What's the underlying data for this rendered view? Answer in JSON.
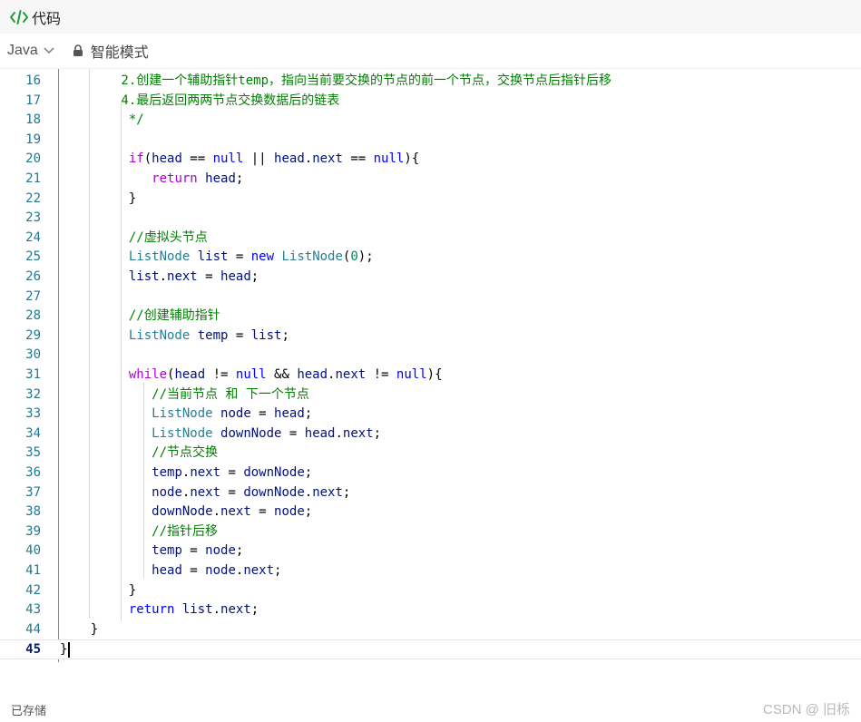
{
  "header": {
    "title": "代码",
    "icon": "code-icon"
  },
  "toolbar": {
    "language": "Java",
    "mode": "智能模式"
  },
  "editor": {
    "current_line": 45,
    "lines": [
      {
        "n": "16",
        "segs": [
          [
            "cm",
            "        2.创建一个辅助指针temp，指向当前要交换的节点的前一个节点，交换节点后指针后移"
          ]
        ]
      },
      {
        "n": "17",
        "segs": [
          [
            "cm",
            "        4.最后返回两两节点交换数据后的链表"
          ]
        ]
      },
      {
        "n": "18",
        "segs": [
          [
            "cm",
            "         */"
          ]
        ]
      },
      {
        "n": "19",
        "segs": []
      },
      {
        "n": "20",
        "segs": [
          [
            "pl",
            "         "
          ],
          [
            "kw",
            "if"
          ],
          [
            "pl",
            "("
          ],
          [
            "id",
            "head"
          ],
          [
            "pl",
            " == "
          ],
          [
            "kw2",
            "null"
          ],
          [
            "pl",
            " || "
          ],
          [
            "id",
            "head"
          ],
          [
            "pl",
            "."
          ],
          [
            "id",
            "next"
          ],
          [
            "pl",
            " == "
          ],
          [
            "kw2",
            "null"
          ],
          [
            "pl",
            "){"
          ]
        ]
      },
      {
        "n": "21",
        "segs": [
          [
            "pl",
            "            "
          ],
          [
            "kw",
            "return"
          ],
          [
            "pl",
            " "
          ],
          [
            "id",
            "head"
          ],
          [
            "pl",
            ";"
          ]
        ]
      },
      {
        "n": "22",
        "segs": [
          [
            "pl",
            "         }"
          ]
        ]
      },
      {
        "n": "23",
        "segs": []
      },
      {
        "n": "24",
        "segs": [
          [
            "cm",
            "         //虚拟头节点"
          ]
        ]
      },
      {
        "n": "25",
        "segs": [
          [
            "pl",
            "         "
          ],
          [
            "cls",
            "ListNode"
          ],
          [
            "pl",
            " "
          ],
          [
            "id",
            "list"
          ],
          [
            "pl",
            " = "
          ],
          [
            "kw2",
            "new"
          ],
          [
            "pl",
            " "
          ],
          [
            "cls",
            "ListNode"
          ],
          [
            "pl",
            "("
          ],
          [
            "num",
            "0"
          ],
          [
            "pl",
            ");"
          ]
        ]
      },
      {
        "n": "26",
        "segs": [
          [
            "pl",
            "         "
          ],
          [
            "id",
            "list"
          ],
          [
            "pl",
            "."
          ],
          [
            "id",
            "next"
          ],
          [
            "pl",
            " = "
          ],
          [
            "id",
            "head"
          ],
          [
            "pl",
            ";"
          ]
        ]
      },
      {
        "n": "27",
        "segs": []
      },
      {
        "n": "28",
        "segs": [
          [
            "cm",
            "         //创建辅助指针"
          ]
        ]
      },
      {
        "n": "29",
        "segs": [
          [
            "pl",
            "         "
          ],
          [
            "cls",
            "ListNode"
          ],
          [
            "pl",
            " "
          ],
          [
            "id",
            "temp"
          ],
          [
            "pl",
            " = "
          ],
          [
            "id",
            "list"
          ],
          [
            "pl",
            ";"
          ]
        ]
      },
      {
        "n": "30",
        "segs": []
      },
      {
        "n": "31",
        "segs": [
          [
            "pl",
            "         "
          ],
          [
            "kw",
            "while"
          ],
          [
            "pl",
            "("
          ],
          [
            "id",
            "head"
          ],
          [
            "pl",
            " != "
          ],
          [
            "kw2",
            "null"
          ],
          [
            "pl",
            " && "
          ],
          [
            "id",
            "head"
          ],
          [
            "pl",
            "."
          ],
          [
            "id",
            "next"
          ],
          [
            "pl",
            " != "
          ],
          [
            "kw2",
            "null"
          ],
          [
            "pl",
            "){"
          ]
        ]
      },
      {
        "n": "32",
        "segs": [
          [
            "cm",
            "            //当前节点 和 下一个节点"
          ]
        ]
      },
      {
        "n": "33",
        "segs": [
          [
            "pl",
            "            "
          ],
          [
            "cls",
            "ListNode"
          ],
          [
            "pl",
            " "
          ],
          [
            "id",
            "node"
          ],
          [
            "pl",
            " = "
          ],
          [
            "id",
            "head"
          ],
          [
            "pl",
            ";"
          ]
        ]
      },
      {
        "n": "34",
        "segs": [
          [
            "pl",
            "            "
          ],
          [
            "cls",
            "ListNode"
          ],
          [
            "pl",
            " "
          ],
          [
            "id",
            "downNode"
          ],
          [
            "pl",
            " = "
          ],
          [
            "id",
            "head"
          ],
          [
            "pl",
            "."
          ],
          [
            "id",
            "next"
          ],
          [
            "pl",
            ";"
          ]
        ]
      },
      {
        "n": "35",
        "segs": [
          [
            "cm",
            "            //节点交换"
          ]
        ]
      },
      {
        "n": "36",
        "segs": [
          [
            "pl",
            "            "
          ],
          [
            "id",
            "temp"
          ],
          [
            "pl",
            "."
          ],
          [
            "id",
            "next"
          ],
          [
            "pl",
            " = "
          ],
          [
            "id",
            "downNode"
          ],
          [
            "pl",
            ";"
          ]
        ]
      },
      {
        "n": "37",
        "segs": [
          [
            "pl",
            "            "
          ],
          [
            "id",
            "node"
          ],
          [
            "pl",
            "."
          ],
          [
            "id",
            "next"
          ],
          [
            "pl",
            " = "
          ],
          [
            "id",
            "downNode"
          ],
          [
            "pl",
            "."
          ],
          [
            "id",
            "next"
          ],
          [
            "pl",
            ";"
          ]
        ]
      },
      {
        "n": "38",
        "segs": [
          [
            "pl",
            "            "
          ],
          [
            "id",
            "downNode"
          ],
          [
            "pl",
            "."
          ],
          [
            "id",
            "next"
          ],
          [
            "pl",
            " = "
          ],
          [
            "id",
            "node"
          ],
          [
            "pl",
            ";"
          ]
        ]
      },
      {
        "n": "39",
        "segs": [
          [
            "cm",
            "            //指针后移"
          ]
        ]
      },
      {
        "n": "40",
        "segs": [
          [
            "pl",
            "            "
          ],
          [
            "id",
            "temp"
          ],
          [
            "pl",
            " = "
          ],
          [
            "id",
            "node"
          ],
          [
            "pl",
            ";"
          ]
        ]
      },
      {
        "n": "41",
        "segs": [
          [
            "pl",
            "            "
          ],
          [
            "id",
            "head"
          ],
          [
            "pl",
            " = "
          ],
          [
            "id",
            "node"
          ],
          [
            "pl",
            "."
          ],
          [
            "id",
            "next"
          ],
          [
            "pl",
            ";"
          ]
        ]
      },
      {
        "n": "42",
        "segs": [
          [
            "pl",
            "         }"
          ]
        ]
      },
      {
        "n": "43",
        "segs": [
          [
            "pl",
            "         "
          ],
          [
            "kw2",
            "return"
          ],
          [
            "pl",
            " "
          ],
          [
            "id",
            "list"
          ],
          [
            "pl",
            "."
          ],
          [
            "id",
            "next"
          ],
          [
            "pl",
            ";"
          ]
        ]
      },
      {
        "n": "44",
        "segs": [
          [
            "pl",
            "    }"
          ]
        ]
      },
      {
        "n": "45",
        "segs": [
          [
            "pl",
            "}"
          ]
        ]
      }
    ]
  },
  "footer": {
    "saved": "已存储",
    "watermark": "CSDN @ 旧栎"
  }
}
